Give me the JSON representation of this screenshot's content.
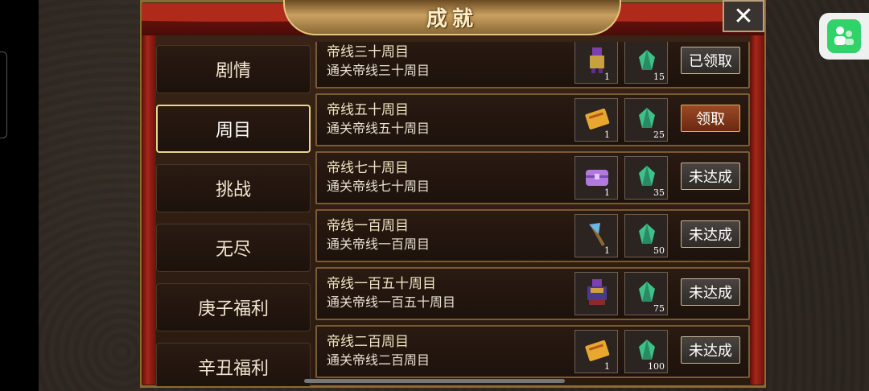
{
  "window": {
    "title": "成就",
    "close_glyph": "✕"
  },
  "tabs": [
    {
      "label": "剧情",
      "active": false
    },
    {
      "label": "周目",
      "active": true
    },
    {
      "label": "挑战",
      "active": false
    },
    {
      "label": "无尽",
      "active": false
    },
    {
      "label": "庚子福利",
      "active": false
    },
    {
      "label": "辛丑福利",
      "active": false
    }
  ],
  "achievements": [
    {
      "title": "帝线三十周目",
      "desc": "通关帝线三十周目",
      "reward1_icon": "purple-warrior-icon",
      "reward1_qty": "1",
      "reward2_icon": "green-crystal-icon",
      "reward2_qty": "15",
      "status": "已领取"
    },
    {
      "title": "帝线五十周目",
      "desc": "通关帝线五十周目",
      "reward1_icon": "golden-book-icon",
      "reward1_qty": "1",
      "reward2_icon": "green-crystal-icon",
      "reward2_qty": "25",
      "status": "领取"
    },
    {
      "title": "帝线七十周目",
      "desc": "通关帝线七十周目",
      "reward1_icon": "purple-chest-icon",
      "reward1_qty": "1",
      "reward2_icon": "green-crystal-icon",
      "reward2_qty": "35",
      "status": "未达成"
    },
    {
      "title": "帝线一百周目",
      "desc": "通关帝线一百周目",
      "reward1_icon": "blue-axe-icon",
      "reward1_qty": "1",
      "reward2_icon": "green-crystal-icon",
      "reward2_qty": "50",
      "status": "未达成"
    },
    {
      "title": "帝线一百五十周目",
      "desc": "通关帝线一百五十周目",
      "reward1_icon": "armored-general-icon",
      "reward1_qty": "",
      "reward2_icon": "green-crystal-icon",
      "reward2_qty": "75",
      "status": "未达成"
    },
    {
      "title": "帝线二百周目",
      "desc": "通关帝线二百周目",
      "reward1_icon": "golden-book-icon",
      "reward1_qty": "1",
      "reward2_icon": "green-crystal-icon",
      "reward2_qty": "100",
      "status": "未达成"
    }
  ],
  "colors": {
    "accent_gold": "#e9d58a",
    "claim_button": "#9a4a26",
    "float_green": "#2fd36a"
  }
}
